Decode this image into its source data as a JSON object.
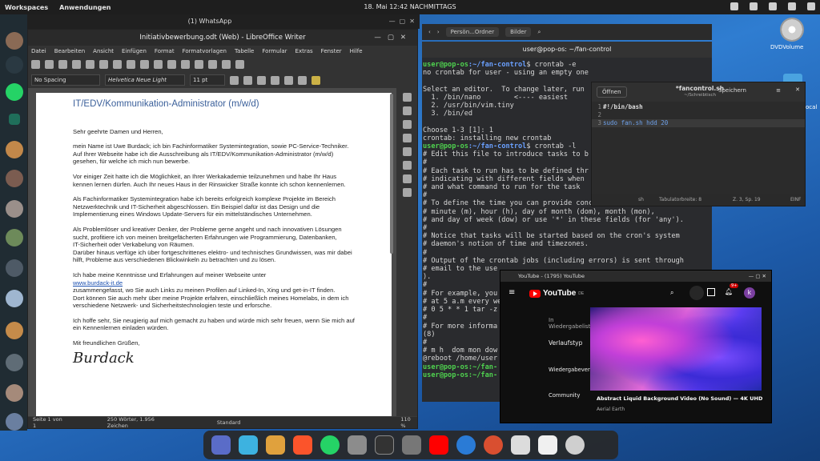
{
  "topbar": {
    "workspaces": "Workspaces",
    "apps": "Anwendungen",
    "clock": "18. Mai 12:42 NACHMITTAGS"
  },
  "whatsapp": {
    "title": "(1) WhatsApp"
  },
  "desktop": {
    "volume_label": "DVDVolume",
    "partial_label": "ocal"
  },
  "writer": {
    "title": "Initiativbewerbung.odt (Web) - LibreOffice Writer",
    "menu": [
      "Datei",
      "Bearbeiten",
      "Ansicht",
      "Einfügen",
      "Format",
      "Formatvorlagen",
      "Tabelle",
      "Formular",
      "Extras",
      "Fenster",
      "Hilfe"
    ],
    "style": "No Spacing",
    "font": "Helvetica Neue Light",
    "size": "11 pt",
    "heading": "IT/EDV/Kommunikation-Administrator (m/w/d)",
    "p1": "Sehr geehrte Damen und Herren,",
    "p2": "mein Name ist Uwe Burdack; ich bin Fachinformatiker Systemintegration, sowie PC-Service-Techniker.\nAuf Ihrer Webseite habe ich die Ausschreibung als IT/EDV/Kommunikation-Administrator (m/w/d) gesehen, für welche ich mich nun bewerbe.",
    "p3": "Vor einiger Zeit hatte ich die Möglichkeit, an Ihrer Werkakademie teilzunehmen und habe Ihr Haus kennen lernen dürfen. Auch Ihr neues Haus in der Rinswicker Straße konnte ich schon kennenlernen.",
    "p4": "Als Fachinformatiker Systemintegration habe ich bereits erfolgreich komplexe Projekte im Bereich Netzwerktechnik und IT-Sicherheit abgeschlossen. Ein Beispiel dafür ist das Design und die Implementierung eines Windows Update-Servers für ein mittelständisches Unternehmen.",
    "p5": "Als Problemlöser und kreativer Denker, der Probleme gerne angeht und nach innovativen Lösungen sucht, profitiere ich von meinen breitgefächerten Erfahrungen wie Programmierung, Datenbanken,\nIT-Sicherheit oder Verkabelung von Räumen.\nDarüber hinaus verfüge ich über fortgeschrittenes elektro- und technisches Grundwissen, was mir dabei hilft, Probleme aus verschiedenen Blickwinkeln zu betrachten und zu lösen.",
    "p6a": "Ich habe meine Kenntnisse und Erfahrungen auf meiner Webseite unter",
    "p6link": "www.burdack-it.de",
    "p6b": "zusammengefasst, wo Sie auch Links zu meinen Profilen auf Linked-In, Xing und get-in-IT finden.\nDort können Sie auch mehr über meine Projekte erfahren, einschließlich meines Homelabs, in dem ich verschiedene Netzwerk- und Sicherheitstechnologien teste und erforsche.",
    "p7": "Ich hoffe sehr, Sie neugierig auf mich gemacht zu haben und würde mich sehr freuen, wenn Sie mich auf ein Kennenlernen einladen würden.",
    "p8": "Mit freundlichen Grüßen,",
    "signature": "Burdack",
    "status": {
      "page": "Seite 1 von 1",
      "words": "250 Wörter, 1.956 Zeichen",
      "style": "Standard",
      "zoom": "110 %"
    }
  },
  "files": {
    "crumb1": "Persön...Ordner",
    "crumb2": "Bilder"
  },
  "terminal": {
    "title": "user@pop-os: ~/fan-control",
    "prompt": "user@pop-os",
    "path": ":~/fan-control",
    "lines": [
      {
        "t": "p",
        "cmd": "$ crontab -e"
      },
      {
        "t": "o",
        "s": "no crontab for user - using an empty one"
      },
      {
        "t": "o",
        "s": ""
      },
      {
        "t": "o",
        "s": "Select an editor.  To change later, run"
      },
      {
        "t": "o",
        "s": "  1. /bin/nano        <---- easiest"
      },
      {
        "t": "o",
        "s": "  2. /usr/bin/vim.tiny"
      },
      {
        "t": "o",
        "s": "  3. /bin/ed"
      },
      {
        "t": "o",
        "s": ""
      },
      {
        "t": "o",
        "s": "Choose 1-3 [1]: 1"
      },
      {
        "t": "o",
        "s": "crontab: installing new crontab"
      },
      {
        "t": "p",
        "cmd": "$ crontab -l"
      },
      {
        "t": "o",
        "s": "# Edit this file to introduce tasks to b"
      },
      {
        "t": "o",
        "s": "#"
      },
      {
        "t": "o",
        "s": "# Each task to run has to be defined thr"
      },
      {
        "t": "o",
        "s": "# indicating with different fields when"
      },
      {
        "t": "o",
        "s": "# and what command to run for the task"
      },
      {
        "t": "o",
        "s": "#"
      },
      {
        "t": "o",
        "s": "# To define the time you can provide concrete values for"
      },
      {
        "t": "o",
        "s": "# minute (m), hour (h), day of month (dom), month (mon),"
      },
      {
        "t": "o",
        "s": "# and day of week (dow) or use '*' in these fields (for 'any')."
      },
      {
        "t": "o",
        "s": "#"
      },
      {
        "t": "o",
        "s": "# Notice that tasks will be started based on the cron's system"
      },
      {
        "t": "o",
        "s": "# daemon's notion of time and timezones."
      },
      {
        "t": "o",
        "s": "#"
      },
      {
        "t": "o",
        "s": "# Output of the crontab jobs (including errors) is sent through"
      },
      {
        "t": "o",
        "s": "# email to the use"
      },
      {
        "t": "o",
        "s": ")."
      },
      {
        "t": "o",
        "s": "#"
      },
      {
        "t": "o",
        "s": "# For example, you"
      },
      {
        "t": "o",
        "s": "# at 5 a.m every we"
      },
      {
        "t": "o",
        "s": "# 0 5 * * 1 tar -z"
      },
      {
        "t": "o",
        "s": "#"
      },
      {
        "t": "o",
        "s": "# For more informa"
      },
      {
        "t": "o",
        "s": "(8)"
      },
      {
        "t": "o",
        "s": "#"
      },
      {
        "t": "o",
        "s": "# m h  dom mon dow"
      },
      {
        "t": "o",
        "s": "@reboot /home/user"
      },
      {
        "t": "p2",
        "s": "user@pop-os:~/fan-"
      },
      {
        "t": "p2",
        "s": "user@pop-os:~/fan-"
      }
    ]
  },
  "editor": {
    "open": "Öffnen",
    "name": "*fancontrol.sh",
    "path": "~/Schreibtisch",
    "save": "Speichern",
    "lines": [
      {
        "n": "1",
        "code": "#!/bin/bash"
      },
      {
        "n": "2",
        "code": ""
      },
      {
        "n": "3",
        "code": "sudo fan.sh hdd 20"
      }
    ],
    "status": {
      "lang": "sh",
      "tab": "Tabulatorbreite: 8",
      "pos": "Z. 3, Sp. 19",
      "mode": "EINF"
    }
  },
  "youtube": {
    "tab": "YouTube - (1795) YouTube",
    "logo": "YouTube",
    "region": "DE",
    "notif": "9+",
    "avatar": "k",
    "side": [
      "In Wiedergabeliste",
      "Verlaufstyp",
      "Wiedergabeverlauf",
      "Community"
    ],
    "video_title": "Abstract Liquid Background Video (No Sound) — 4K UHD ...",
    "channel": "Aerial Earth"
  }
}
